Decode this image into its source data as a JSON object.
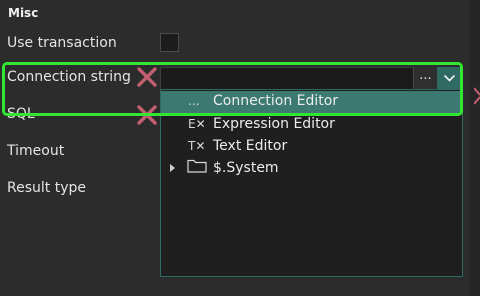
{
  "section": {
    "title": "Misc"
  },
  "properties": [
    {
      "label": "Use transaction"
    },
    {
      "label": "Connection string"
    },
    {
      "label": "SQL"
    },
    {
      "label": "Timeout"
    },
    {
      "label": "Result type"
    }
  ],
  "combo": {
    "value": "",
    "ellipsis_label": "...",
    "dropdown_icon": "chevron-down-icon"
  },
  "dropdown": {
    "items": [
      {
        "icon": "...",
        "label": "Connection Editor",
        "selected": true
      },
      {
        "icon": "E✕",
        "label": "Expression Editor",
        "selected": false
      },
      {
        "icon": "T✕",
        "label": "Text Editor",
        "selected": false
      },
      {
        "icon": "folder-icon",
        "label": "$.System",
        "selected": false
      }
    ]
  },
  "colors": {
    "accent": "#3c7a71",
    "highlight": "#33e633",
    "remove_icon": "#c2606f"
  }
}
